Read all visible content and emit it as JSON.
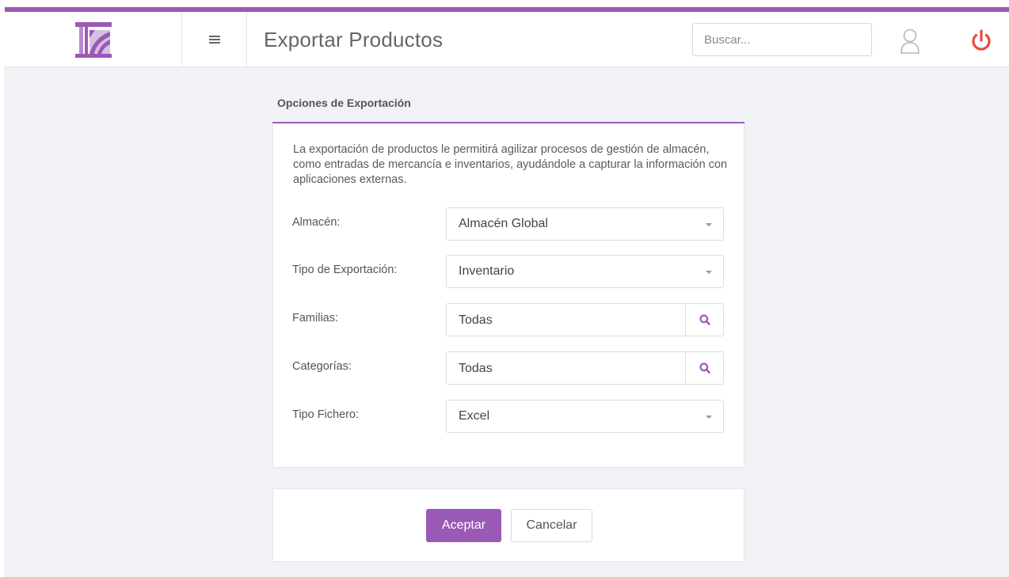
{
  "header": {
    "title": "Exportar Productos",
    "search_placeholder": "Buscar...",
    "icons": {
      "logo": "logo-columns",
      "menu": "hamburger-icon",
      "user": "user-icon",
      "power": "power-icon"
    }
  },
  "panel": {
    "title": "Opciones de Exportación",
    "description": "La exportación de productos le permitirá agilizar procesos de gestión de almacén, como entradas de mercancía e inventarios, ayudándole a capturar la información con aplicaciones externas.",
    "fields": {
      "almacen": {
        "label": "Almacén:",
        "value": "Almacén Global"
      },
      "tipo_exportacion": {
        "label": "Tipo de Exportación:",
        "value": "Inventario"
      },
      "familias": {
        "label": "Familias:",
        "value": "Todas"
      },
      "categorias": {
        "label": "Categorías:",
        "value": "Todas"
      },
      "tipo_fichero": {
        "label": "Tipo Fichero:",
        "value": "Excel"
      }
    }
  },
  "actions": {
    "accept_label": "Aceptar",
    "cancel_label": "Cancelar"
  },
  "colors": {
    "accent": "#9b59b6",
    "power": "#e74c3c",
    "background": "#f1f2f6"
  }
}
